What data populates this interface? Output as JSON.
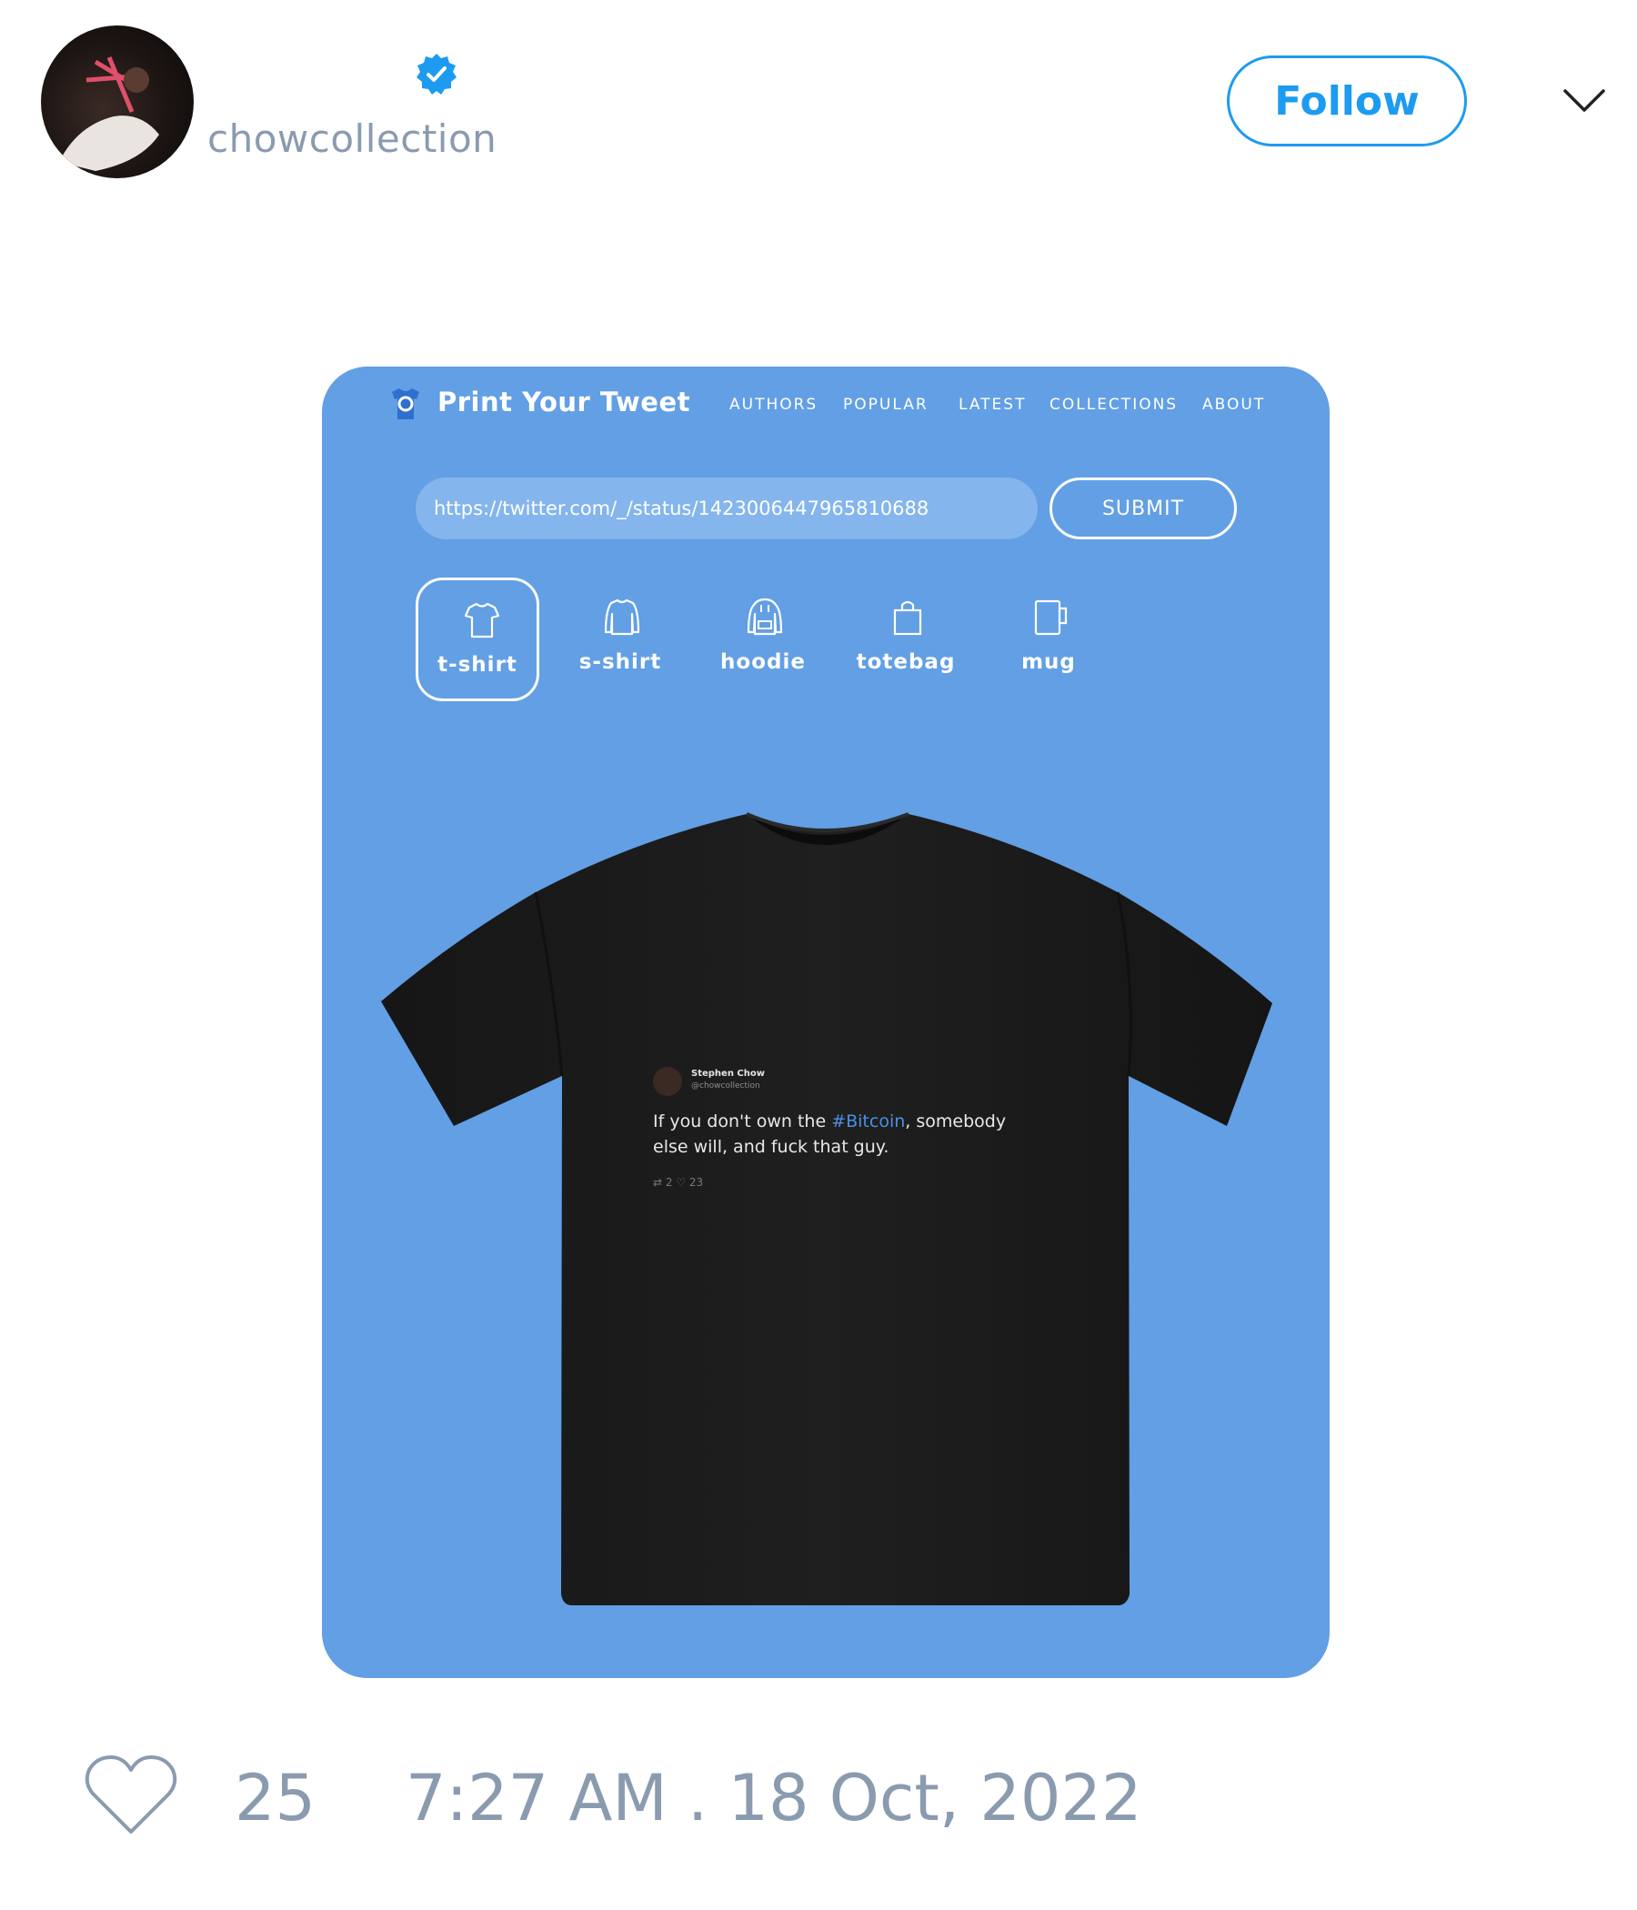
{
  "header": {
    "handle": "chowcollection",
    "verified": true,
    "follow_label": "Follow",
    "menu_icon": "chevron-down-icon",
    "accent_color": "#1d9bf0"
  },
  "media": {
    "site_brand": "Print Your Tweet",
    "nav": [
      "AUTHORS",
      "POPULAR",
      "LATEST",
      "COLLECTIONS",
      "ABOUT"
    ],
    "url_value": "https://twitter.com/_/status/1423006447965810688",
    "submit_label": "SUBMIT",
    "products": [
      {
        "label": "t-shirt",
        "icon": "tshirt-icon",
        "selected": true
      },
      {
        "label": "s-shirt",
        "icon": "sweatshirt-icon",
        "selected": false
      },
      {
        "label": "hoodie",
        "icon": "hoodie-icon",
        "selected": false
      },
      {
        "label": "totebag",
        "icon": "totebag-icon",
        "selected": false
      },
      {
        "label": "mug",
        "icon": "mug-icon",
        "selected": false
      }
    ],
    "background_color": "#629fe4",
    "printed_tweet": {
      "name": "Stephen Chow",
      "handle": "@chowcollection",
      "text_before": "If you don't own the ",
      "hashtag": "#Bitcoin",
      "text_after": ", somebody else will, and fuck that guy.",
      "stats": "⇄ 2   ♡ 23"
    }
  },
  "footer": {
    "likes": "25",
    "timestamp": "7:27 AM . 18 Oct, 2022"
  }
}
